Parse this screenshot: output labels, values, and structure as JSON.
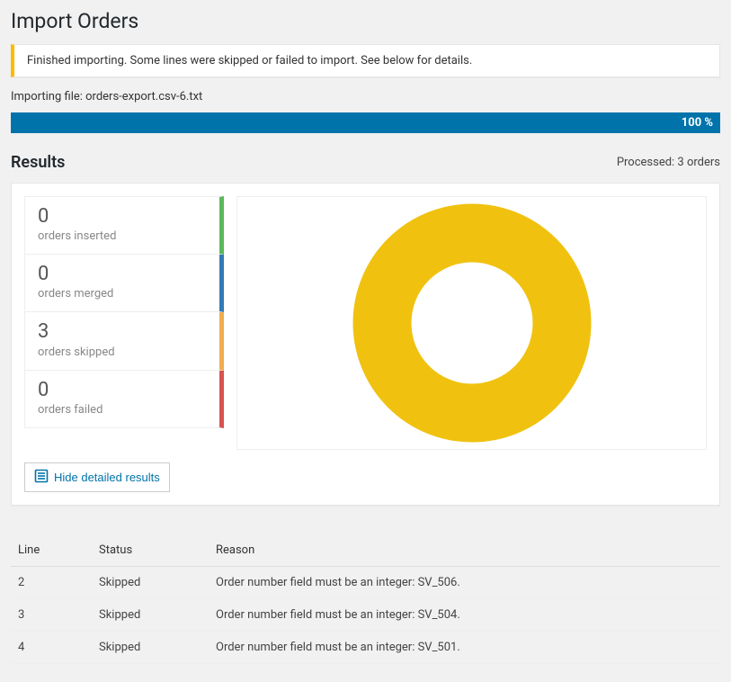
{
  "page_title": "Import Orders",
  "notice": "Finished importing. Some lines were skipped or failed to import. See below for details.",
  "importing_file_label": "Importing file: orders-export.csv-6.txt",
  "progress_text": "100 %",
  "results_title": "Results",
  "processed_text": "Processed: 3 orders",
  "stats": {
    "inserted": {
      "value": "0",
      "label": "orders inserted"
    },
    "merged": {
      "value": "0",
      "label": "orders merged"
    },
    "skipped": {
      "value": "3",
      "label": "orders skipped"
    },
    "failed": {
      "value": "0",
      "label": "orders failed"
    }
  },
  "hide_details_label": "Hide detailed results",
  "table": {
    "headers": {
      "line": "Line",
      "status": "Status",
      "reason": "Reason"
    },
    "rows": [
      {
        "line": "2",
        "status": "Skipped",
        "reason": "Order number field must be an integer: SV_506."
      },
      {
        "line": "3",
        "status": "Skipped",
        "reason": "Order number field must be an integer: SV_504."
      },
      {
        "line": "4",
        "status": "Skipped",
        "reason": "Order number field must be an integer: SV_501."
      }
    ]
  },
  "chart_data": {
    "type": "pie",
    "title": "",
    "categories": [
      "orders inserted",
      "orders merged",
      "orders skipped",
      "orders failed"
    ],
    "values": [
      0,
      0,
      3,
      0
    ],
    "colors": [
      "#5cb85c",
      "#337ab7",
      "#f0c20f",
      "#d9534f"
    ]
  }
}
